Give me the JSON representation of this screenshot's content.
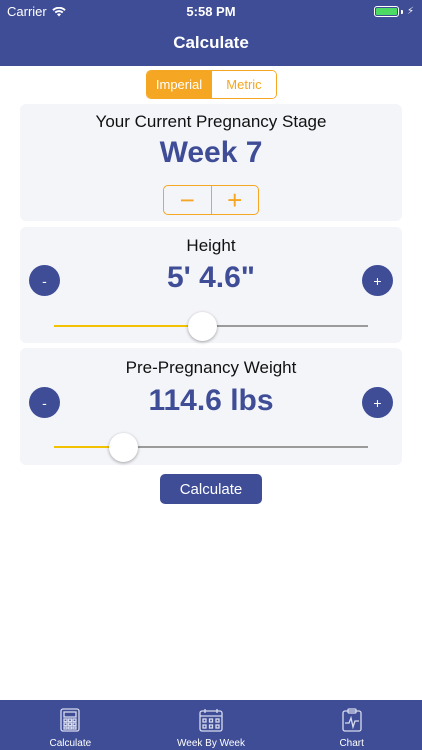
{
  "status_bar": {
    "carrier": "Carrier",
    "time": "5:58 PM"
  },
  "nav": {
    "title": "Calculate"
  },
  "units": {
    "options": [
      "Imperial",
      "Metric"
    ],
    "selected": "Imperial"
  },
  "stage": {
    "label": "Your Current Pregnancy Stage",
    "value": "Week 7",
    "decrement": "−",
    "increment": "+"
  },
  "height": {
    "label": "Height",
    "value": "5'  4.6\"",
    "minus": "-",
    "plus": "+",
    "slider_fraction": 0.47
  },
  "weight": {
    "label": "Pre-Pregnancy Weight",
    "value": "114.6 lbs",
    "minus": "-",
    "plus": "+",
    "slider_fraction": 0.22
  },
  "calculate_button": "Calculate",
  "tabs": [
    {
      "label": "Calculate",
      "icon": "calculator-icon"
    },
    {
      "label": "Week By Week",
      "icon": "calendar-icon"
    },
    {
      "label": "Chart",
      "icon": "chart-icon"
    }
  ],
  "colors": {
    "primary": "#3f4d97",
    "accent": "#f5a623",
    "slider_fill": "#f2c200"
  }
}
